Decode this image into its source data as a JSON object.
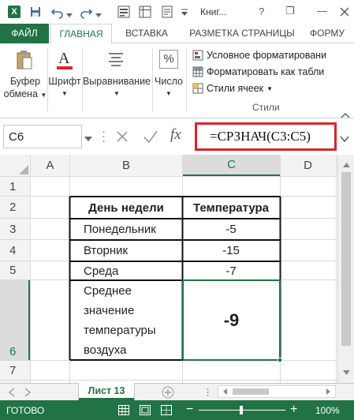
{
  "window": {
    "title": "Книг...",
    "excel_icon": "X",
    "minimize": "—",
    "restore": "❐",
    "help": "?"
  },
  "ribbon_tabs": {
    "file": "ФАЙЛ",
    "home": "ГЛАВНАЯ",
    "insert": "ВСТАВКА",
    "page_layout": "РАЗМЕТКА СТРАНИЦЫ",
    "formulas": "ФОРМУ"
  },
  "ribbon": {
    "clipboard_line1": "Буфер",
    "clipboard_line2": "обмена",
    "font": "Шрифт",
    "alignment": "Выравнивание",
    "number": "Число",
    "number_icon": "%",
    "conditional_formatting": "Условное форматировани",
    "format_as_table": "Форматировать как табли",
    "cell_styles": "Стили ячеек",
    "styles_group": "Стили"
  },
  "formula_bar": {
    "name_box": "C6",
    "formula": "=СРЗНАЧ(C3:C5)",
    "fx": "fx"
  },
  "grid": {
    "columns": [
      "A",
      "B",
      "C",
      "D"
    ],
    "rows": [
      "1",
      "2",
      "3",
      "4",
      "5",
      "6",
      "7"
    ],
    "table_header_day": "День недели",
    "table_header_temp": "Температура",
    "day_1": "Понедельник",
    "day_2": "Вторник",
    "day_3": "Среда",
    "temp_1": "-5",
    "temp_2": "-15",
    "temp_3": "-7",
    "avg_label": "Среднее значение температуры воздуха",
    "avg_value": "-9"
  },
  "sheets": {
    "active": "Лист 13"
  },
  "status": {
    "ready": "ГОТОВО",
    "zoom": "100%"
  },
  "colors": {
    "excel_green": "#217346",
    "formula_highlight": "#d9262c",
    "selection_green": "#217346"
  }
}
